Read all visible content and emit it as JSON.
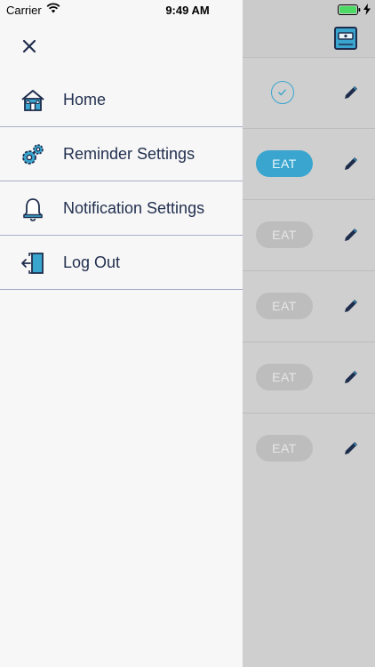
{
  "status_bar": {
    "carrier": "Carrier",
    "time": "9:49 AM"
  },
  "drawer": {
    "items": [
      {
        "label": "Home",
        "icon": "house-icon"
      },
      {
        "label": "Reminder Settings",
        "icon": "gears-icon"
      },
      {
        "label": "Notification Settings",
        "icon": "bell-icon"
      },
      {
        "label": "Log Out",
        "icon": "logout-icon"
      }
    ]
  },
  "main": {
    "rows": [
      {
        "state": "done"
      },
      {
        "state": "active",
        "label": "EAT"
      },
      {
        "state": "inactive",
        "label": "EAT"
      },
      {
        "state": "inactive",
        "label": "EAT"
      },
      {
        "state": "inactive",
        "label": "EAT"
      },
      {
        "state": "inactive",
        "label": "EAT"
      }
    ]
  },
  "colors": {
    "accent": "#3aa6cf",
    "drawer_bg": "#f7f7f7",
    "text": "#22304f",
    "overlay": "#cfcfcf"
  }
}
